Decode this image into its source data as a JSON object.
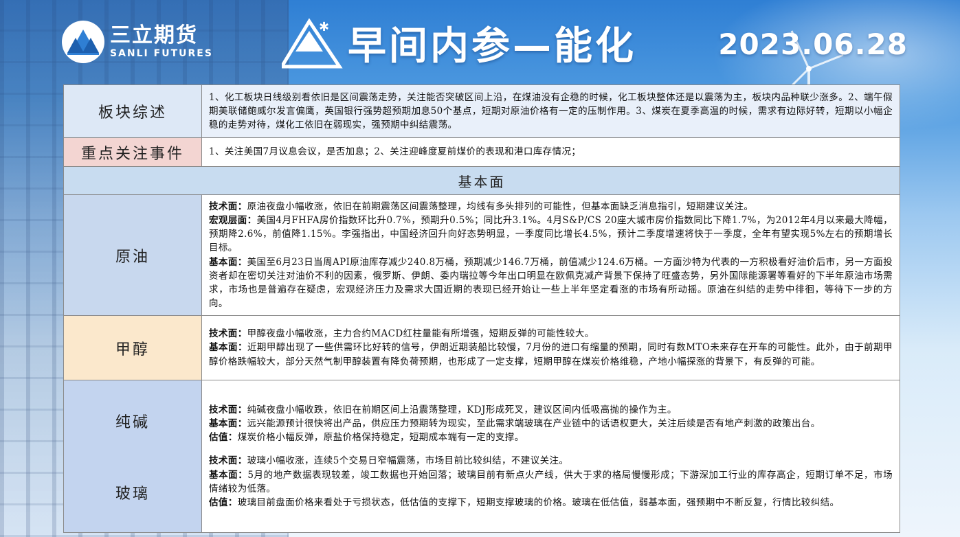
{
  "header": {
    "logo_cn": "三立期货",
    "logo_en": "SANLI FUTURES",
    "title": "早间内参—能化",
    "date": "2023.06.28"
  },
  "rows": {
    "overview": {
      "label": "板块综述",
      "text": "1、化工板块日线级别看依旧是区间震荡走势，关注能否突破区间上沿，在煤油没有企稳的时候，化工板块整体还是以震荡为主，板块内品种联少涨多。2、端午假期美联储鲍威尔发言偏鹰，英国银行强势超预期加息50个基点，短期对原油价格有一定的压制作用。3、煤炭在夏季高温的时候，需求有边际好转，短期以小幅企稳的走势对待，煤化工依旧在弱现实，强预期中纠结震荡。"
    },
    "focus": {
      "label": "重点关注事件",
      "text": "1、关注美国7月议息会议，是否加息；2、关注迎峰度夏前煤价的表现和港口库存情况；"
    },
    "fundamentals_header": "基本面",
    "crude": {
      "label": "原油",
      "items": [
        {
          "k": "技术面：",
          "v": "原油夜盘小幅收涨，依旧在前期震荡区间震荡整理，均线有多头排列的可能性，但基本面缺乏消息指引，短期建议关注。"
        },
        {
          "k": "宏观层面：",
          "v": "美国4月FHFA房价指数环比升0.7%，预期升0.5%；同比升3.1%。4月S&P/CS 20座大城市房价指数同比下降1.7%，为2012年4月以来最大降幅，预期降2.6%，前值降1.15%。李强指出，中国经济回升向好态势明显，一季度同比增长4.5%，预计二季度增速将快于一季度，全年有望实现5%左右的预期增长目标。"
        },
        {
          "k": "基本面：",
          "v": "美国至6月23日当周API原油库存减少240.8万桶，预期减少146.7万桶，前值减少124.6万桶。一方面沙特为代表的一方积极看好油价后市，另一方面投资者却在密切关注对油价不利的因素，俄罗斯、伊朗、委内瑞拉等今年出口明显在欧佩克减产背景下保持了旺盛态势，另外国际能源署等看好的下半年原油市场需求，市场也是普遍存在疑虑，宏观经济压力及需求大国近期的表现已经开始让一些上半年坚定看涨的市场有所动摇。原油在纠结的走势中徘徊，等待下一步的方向。"
        }
      ]
    },
    "methanol": {
      "label": "甲醇",
      "items": [
        {
          "k": "技术面：",
          "v": "甲醇夜盘小幅收涨，主力合约MACD红柱量能有所增强，短期反弹的可能性较大。"
        },
        {
          "k": "基本面：",
          "v": "近期甲醇出现了一些供需环比好转的信号，伊朗近期装船比较慢，7月份的进口有缩量的预期，同时有数MTO未来存在开车的可能性。此外，由于前期甲醇价格跌幅较大，部分天然气制甲醇装置有降负荷预期，也形成了一定支撑，短期甲醇在煤炭价格维稳，产地小幅探涨的背景下，有反弹的可能。"
        }
      ]
    },
    "soda_glass": {
      "labels": [
        "纯碱",
        "玻璃"
      ],
      "soda_items": [
        {
          "k": "技术面：",
          "v": "纯碱夜盘小幅收跌，依旧在前期区间上沿震荡整理，KDJ形成死叉，建议区间内低吸高抛的操作为主。"
        },
        {
          "k": "基本面：",
          "v": "远兴能源预计很快将出产品，供应压力预期转为现实，至此需求端玻璃在产业链中的话语权更大，关注后续是否有地产刺激的政策出台。"
        },
        {
          "k": "估值：",
          "v": "煤炭价格小幅反弹，原盐价格保持稳定，短期成本端有一定的支撑。"
        }
      ],
      "glass_items": [
        {
          "k": "技术面：",
          "v": "玻璃小幅收涨，连续5个交易日窄幅震荡，市场目前比较纠结，不建议关注。"
        },
        {
          "k": "基本面：",
          "v": "5月的地产数据表现较差，竣工数据也开始回落；玻璃目前有新点火产线，供大于求的格局慢慢形成；下游深加工行业的库存高企，短期订单不足，市场情绪较为低落。"
        },
        {
          "k": "估值：",
          "v": "玻璃目前盘面价格来看处于亏损状态，低估值的支撑下，短期支撑玻璃的价格。玻璃在低估值，弱基本面，强预期中不断反复，行情比较纠结。"
        }
      ]
    }
  }
}
